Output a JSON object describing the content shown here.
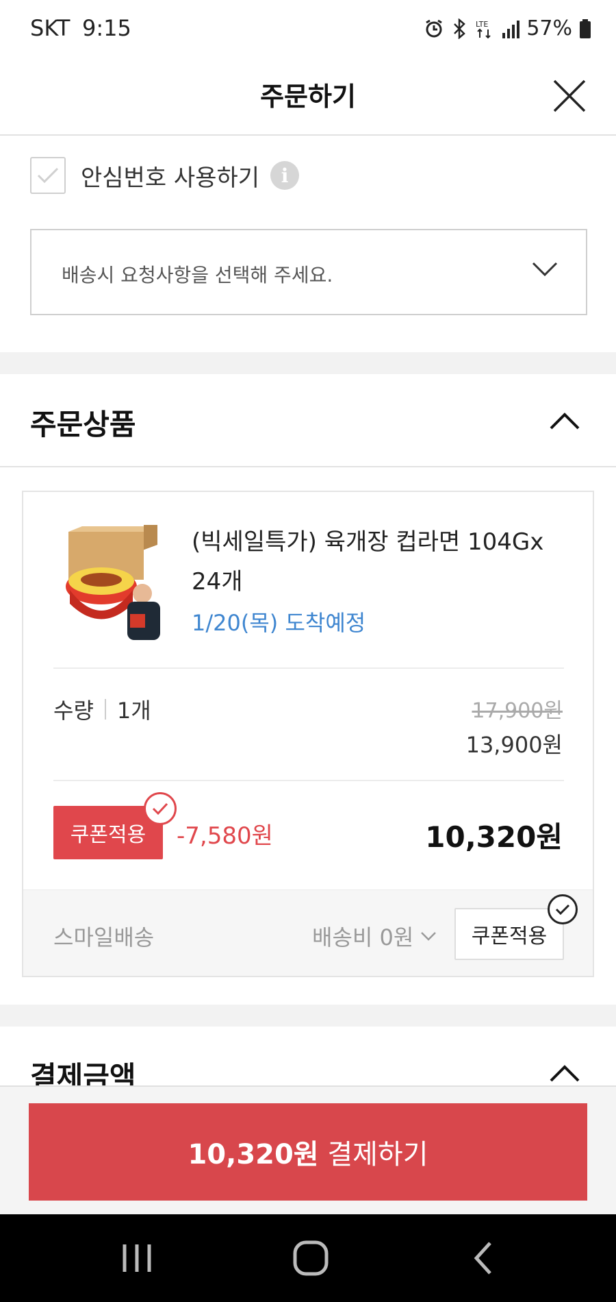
{
  "status_bar": {
    "carrier": "SKT",
    "time": "9:15",
    "battery": "57%"
  },
  "header": {
    "title": "주문하기"
  },
  "safe_number": {
    "label": "안심번호 사용하기",
    "info": "i"
  },
  "delivery_request": {
    "placeholder": "배송시 요청사항을 선택해 주세요."
  },
  "order_items": {
    "title": "주문상품",
    "product": {
      "name": "(빅세일특가) 육개장 컵라면 104Gx 24개",
      "arrival": "1/20(목) 도착예정",
      "quantity_label": "수량",
      "quantity": "1개",
      "original_price": "17,900원",
      "sale_price": "13,900원",
      "coupon_label": "쿠폰적용",
      "discount": "-7,580원",
      "final_price": "10,320원"
    },
    "shipping": {
      "method": "스마일배송",
      "fee": "배송비 0원",
      "coupon_label": "쿠폰적용"
    }
  },
  "payment_amount": {
    "title": "결제금액"
  },
  "pay_button": {
    "amount": "10,320원",
    "label": " 결제하기"
  },
  "colors": {
    "accent": "#d8474c",
    "link": "#3f86d0"
  }
}
